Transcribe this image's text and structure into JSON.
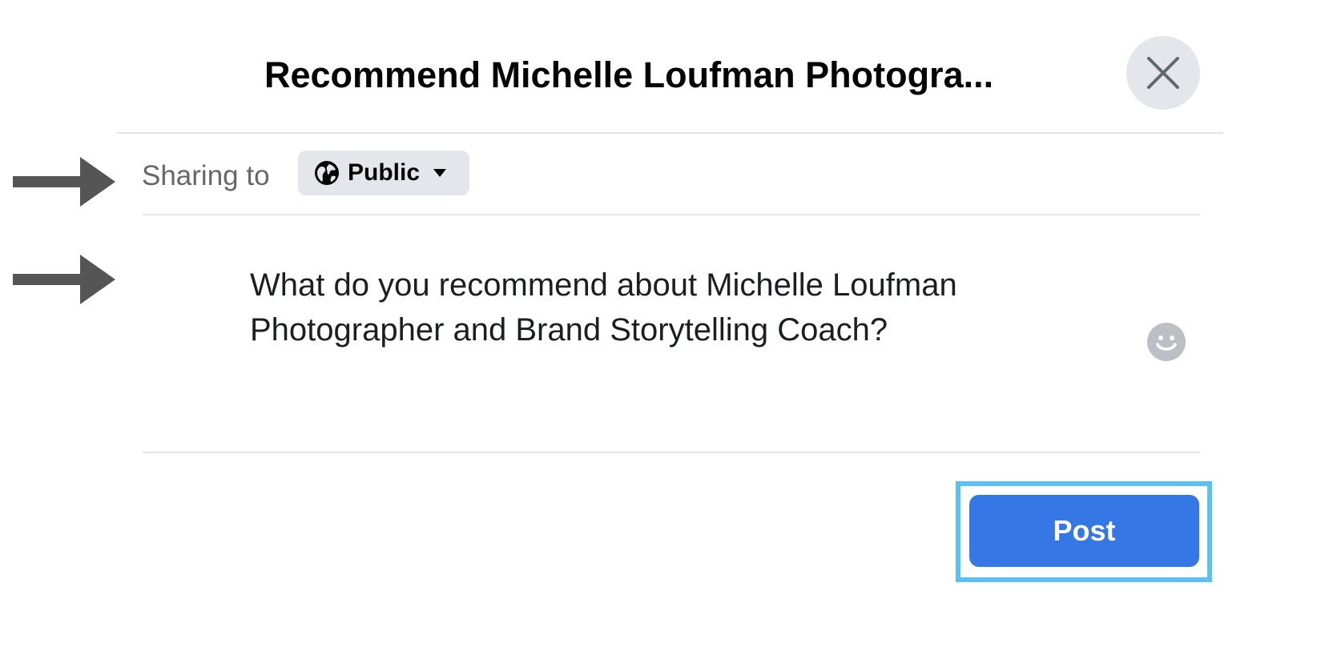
{
  "dialog": {
    "title": "Recommend Michelle Loufman Photogra..."
  },
  "sharing": {
    "label": "Sharing to",
    "audience": "Public"
  },
  "composer": {
    "prompt": "What do you recommend about Michelle Loufman Photographer and Brand Storytelling Coach?"
  },
  "actions": {
    "post_label": "Post"
  },
  "icons": {
    "close": "close-icon",
    "audience": "globe-icon",
    "dropdown": "caret-down-icon",
    "emoji": "smiley-icon",
    "annotation": "arrow-right-icon"
  },
  "colors": {
    "primary": "#3578e5",
    "highlight": "#58c3f2",
    "secondary_bg": "#e4e6eb",
    "secondary_text": "#65676b",
    "arrow": "#555555"
  }
}
